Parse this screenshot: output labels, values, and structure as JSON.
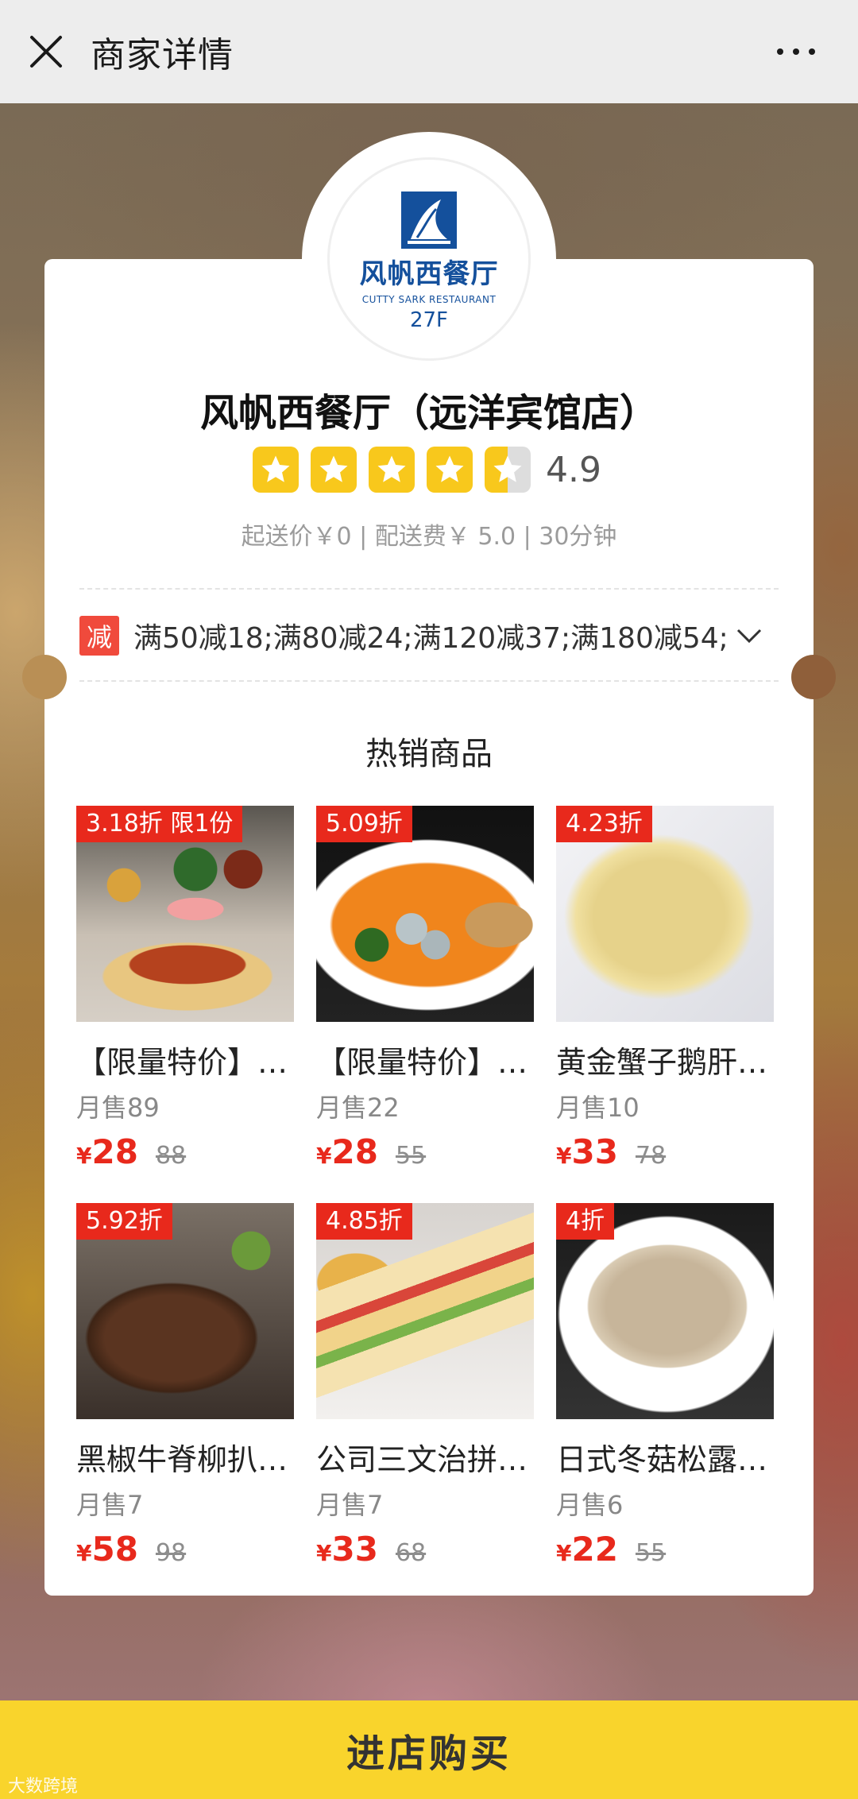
{
  "header": {
    "title": "商家详情"
  },
  "logo": {
    "name_cn": "风帆西餐厅",
    "name_en": "CUTTY SARK RESTAURANT",
    "floor": "27F"
  },
  "shop": {
    "name": "风帆西餐厅（远洋宾馆店）",
    "rating": 4.9,
    "rating_text": "4.9",
    "delivery_info": "起送价￥0 | 配送费￥ 5.0 | 30分钟"
  },
  "promo": {
    "badge": "减",
    "text": "满50减18;满80减24;满120减37;满180减54;"
  },
  "section": {
    "title": "热销商品"
  },
  "products": [
    {
      "discount": "3.18折 限1份",
      "name": "【限量特价】…",
      "sales": "月售89",
      "price": "28",
      "original": "88"
    },
    {
      "discount": "5.09折",
      "name": "【限量特价】…",
      "sales": "月售22",
      "price": "28",
      "original": "55"
    },
    {
      "discount": "4.23折",
      "name": "黄金蟹子鹅肝…",
      "sales": "月售10",
      "price": "33",
      "original": "78"
    },
    {
      "discount": "5.92折",
      "name": "黑椒牛脊柳扒…",
      "sales": "月售7",
      "price": "58",
      "original": "98"
    },
    {
      "discount": "4.85折",
      "name": "公司三文治拼…",
      "sales": "月售7",
      "price": "33",
      "original": "68"
    },
    {
      "discount": "4折",
      "name": "日式冬菇松露…",
      "sales": "月售6",
      "price": "22",
      "original": "55"
    }
  ],
  "currency_symbol": "¥",
  "buy_button": {
    "label": "进店购买"
  },
  "watermark": {
    "text": "大数跨境"
  },
  "colors": {
    "accent": "#e8291c",
    "star": "#f8c81c",
    "buy_bar": "#f9d42c"
  },
  "icons": {
    "close": "close-icon",
    "more": "more-icon",
    "chevron": "chevron-down-icon"
  }
}
